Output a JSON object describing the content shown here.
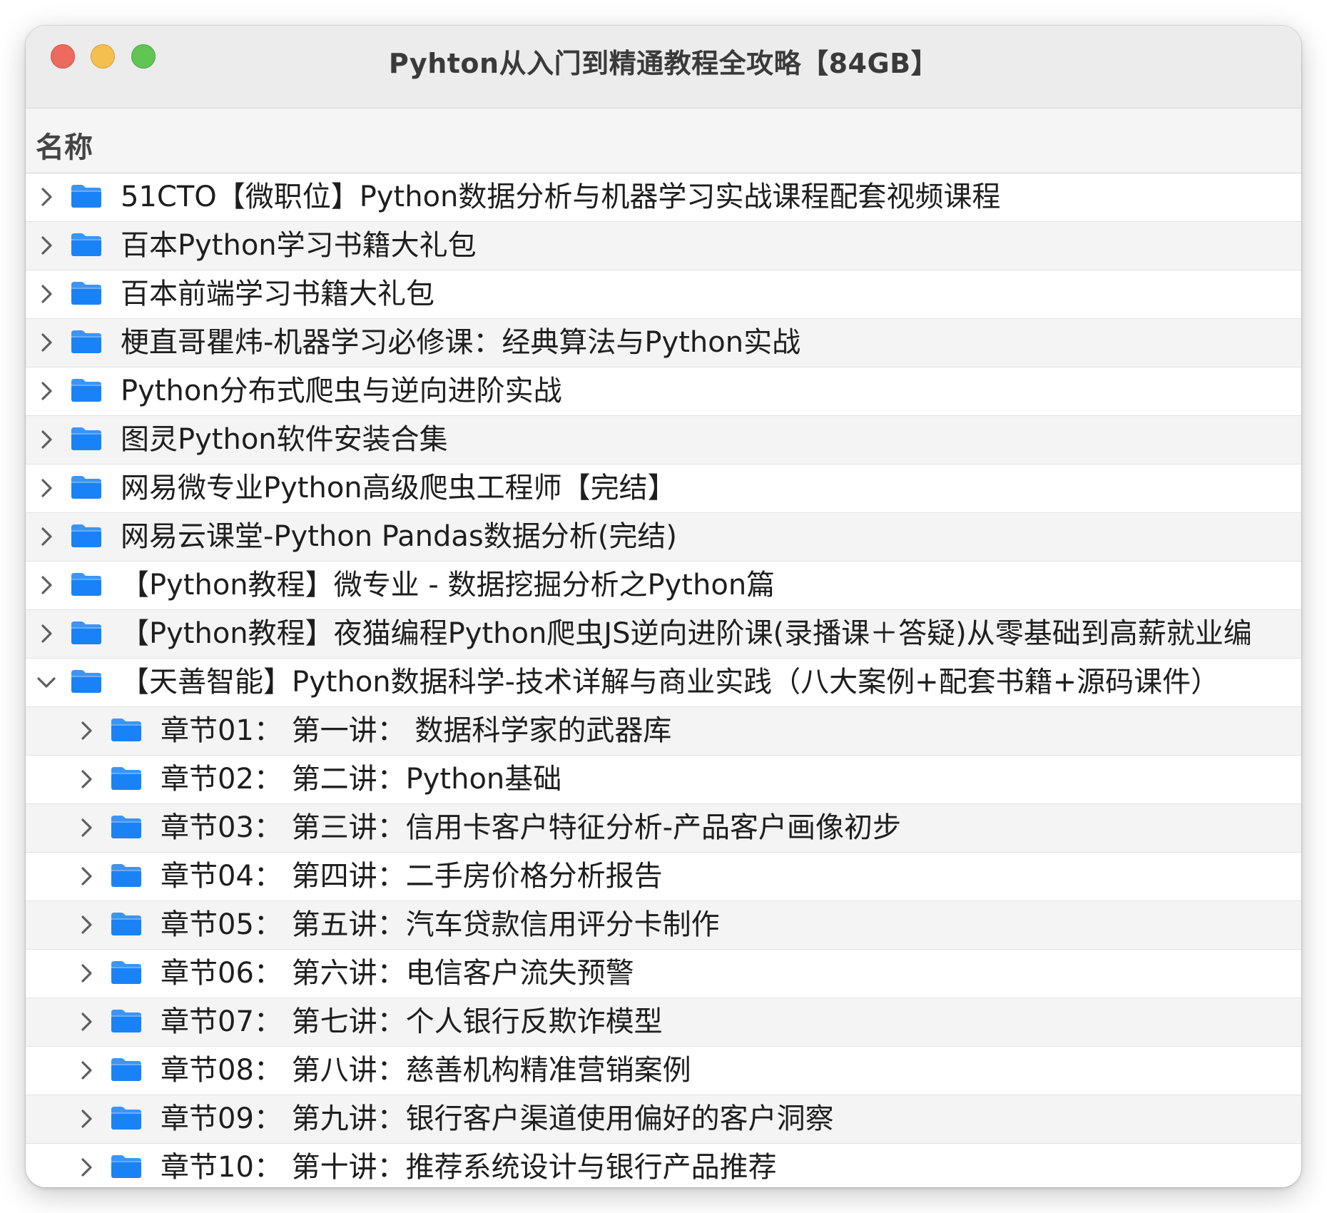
{
  "window": {
    "title": "Pyhton从入门到精通教程全攻略【84GB】"
  },
  "header": {
    "name_column": "名称"
  },
  "colors": {
    "folder_blue": "#1a82f7",
    "close": "#ed6a5e",
    "minimize": "#f5bf4f",
    "maximize": "#61c554"
  },
  "rows": [
    {
      "label": "51CTO【微职位】Python数据分析与机器学习实战课程配套视频课程",
      "level": 0,
      "expanded": false
    },
    {
      "label": "百本Python学习书籍大礼包",
      "level": 0,
      "expanded": false
    },
    {
      "label": "百本前端学习书籍大礼包",
      "level": 0,
      "expanded": false
    },
    {
      "label": "梗直哥瞿炜-机器学习必修课：经典算法与Python实战",
      "level": 0,
      "expanded": false
    },
    {
      "label": "Python分布式爬虫与逆向进阶实战",
      "level": 0,
      "expanded": false
    },
    {
      "label": "图灵Python软件安装合集",
      "level": 0,
      "expanded": false
    },
    {
      "label": "网易微专业Python高级爬虫工程师【完结】",
      "level": 0,
      "expanded": false
    },
    {
      "label": "网易云课堂-Python Pandas数据分析(完结)",
      "level": 0,
      "expanded": false
    },
    {
      "label": "【Python教程】微专业 - 数据挖掘分析之Python篇",
      "level": 0,
      "expanded": false
    },
    {
      "label": "【Python教程】夜猫编程Python爬虫JS逆向进阶课(录播课＋答疑)从零基础到高薪就业编",
      "level": 0,
      "expanded": false
    },
    {
      "label": "【天善智能】Python数据科学-技术详解与商业实践（八大案例+配套书籍+源码课件）",
      "level": 0,
      "expanded": true
    },
    {
      "label": "章节01：  第一讲：  数据科学家的武器库",
      "level": 1,
      "expanded": false
    },
    {
      "label": "章节02：  第二讲：Python基础",
      "level": 1,
      "expanded": false
    },
    {
      "label": "章节03：  第三讲：信用卡客户特征分析-产品客户画像初步",
      "level": 1,
      "expanded": false
    },
    {
      "label": "章节04：  第四讲：二手房价格分析报告",
      "level": 1,
      "expanded": false
    },
    {
      "label": "章节05：  第五讲：汽车贷款信用评分卡制作",
      "level": 1,
      "expanded": false
    },
    {
      "label": "章节06：  第六讲：电信客户流失预警",
      "level": 1,
      "expanded": false
    },
    {
      "label": "章节07：  第七讲：个人银行反欺诈模型",
      "level": 1,
      "expanded": false
    },
    {
      "label": "章节08：  第八讲：慈善机构精准营销案例",
      "level": 1,
      "expanded": false
    },
    {
      "label": "章节09：  第九讲：银行客户渠道使用偏好的客户洞察",
      "level": 1,
      "expanded": false
    },
    {
      "label": "章节10：  第十讲：推荐系统设计与银行产品推荐",
      "level": 1,
      "expanded": false
    }
  ]
}
